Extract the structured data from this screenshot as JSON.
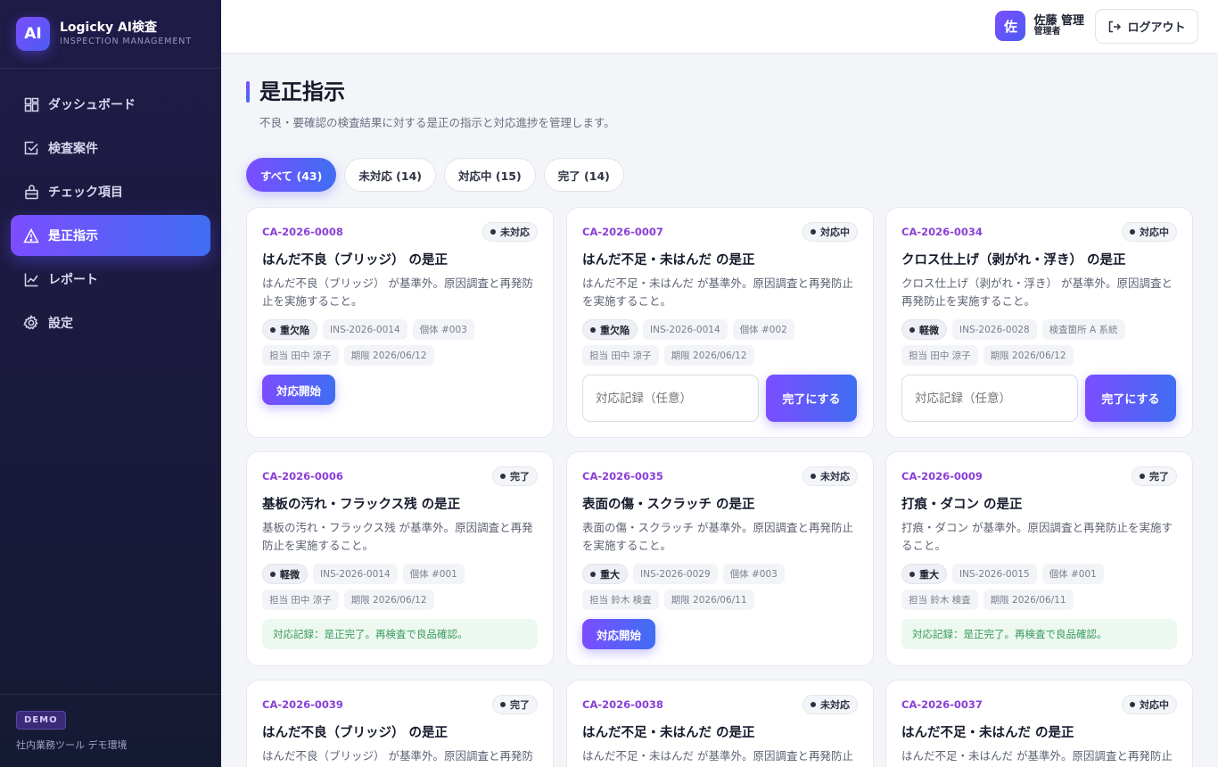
{
  "app": {
    "logo": "AI",
    "title": "Logicky AI検査",
    "subtitle": "INSPECTION MANAGEMENT"
  },
  "sidebar": {
    "items": [
      {
        "label": "ダッシュボード",
        "icon": "dashboard-icon"
      },
      {
        "label": "検査案件",
        "icon": "checkbox-icon"
      },
      {
        "label": "チェック項目",
        "icon": "clipboard-icon"
      },
      {
        "label": "是正指示",
        "icon": "warning-icon",
        "active": true
      },
      {
        "label": "レポート",
        "icon": "chart-icon"
      },
      {
        "label": "設定",
        "icon": "gear-icon"
      }
    ],
    "demo_badge": "DEMO",
    "demo_text": "社内業務ツール デモ環境"
  },
  "header": {
    "avatar": "佐",
    "user_name": "佐藤 管理",
    "user_role": "管理者",
    "logout_label": "ログアウト"
  },
  "page": {
    "title": "是正指示",
    "description": "不良・要確認の検査結果に対する是正の指示と対応進捗を管理します。"
  },
  "tabs": [
    {
      "label": "すべて (43)",
      "active": true
    },
    {
      "label": "未対応 (14)"
    },
    {
      "label": "対応中 (15)"
    },
    {
      "label": "完了 (14)"
    }
  ],
  "labels": {
    "start_button": "対応開始",
    "record_placeholder": "対応記録（任意）",
    "complete_button": "完了にする"
  },
  "cards": [
    {
      "id": "CA-2026-0008",
      "status": "未対応",
      "title": "はんだ不良（ブリッジ） の是正",
      "desc": "はんだ不良（ブリッジ） が基準外。原因調査と再発防止を実施すること。",
      "severity": "重欠陥",
      "inspection": "INS-2026-0014",
      "target": "個体 #003",
      "assignee": "担当 田中 涼子",
      "due": "期限 2026/06/12"
    },
    {
      "id": "CA-2026-0007",
      "status": "対応中",
      "title": "はんだ不足・未はんだ の是正",
      "desc": "はんだ不足・未はんだ が基準外。原因調査と再発防止を実施すること。",
      "severity": "重欠陥",
      "inspection": "INS-2026-0014",
      "target": "個体 #002",
      "assignee": "担当 田中 涼子",
      "due": "期限 2026/06/12"
    },
    {
      "id": "CA-2026-0034",
      "status": "対応中",
      "title": "クロス仕上げ（剥がれ・浮き） の是正",
      "desc": "クロス仕上げ（剥がれ・浮き） が基準外。原因調査と再発防止を実施すること。",
      "severity": "軽微",
      "inspection": "INS-2026-0028",
      "target": "検査箇所 A 系統",
      "assignee": "担当 田中 涼子",
      "due": "期限 2026/06/12"
    },
    {
      "id": "CA-2026-0006",
      "status": "完了",
      "title": "基板の汚れ・フラックス残 の是正",
      "desc": "基板の汚れ・フラックス残 が基準外。原因調査と再発防止を実施すること。",
      "severity": "軽微",
      "inspection": "INS-2026-0014",
      "target": "個体 #001",
      "assignee": "担当 田中 涼子",
      "due": "期限 2026/06/12",
      "note": "対応記録：是正完了。再検査で良品確認。"
    },
    {
      "id": "CA-2026-0035",
      "status": "未対応",
      "title": "表面の傷・スクラッチ の是正",
      "desc": "表面の傷・スクラッチ が基準外。原因調査と再発防止を実施すること。",
      "severity": "重大",
      "inspection": "INS-2026-0029",
      "target": "個体 #003",
      "assignee": "担当 鈴木 検査",
      "due": "期限 2026/06/11"
    },
    {
      "id": "CA-2026-0009",
      "status": "完了",
      "title": "打痕・ダコン の是正",
      "desc": "打痕・ダコン が基準外。原因調査と再発防止を実施すること。",
      "severity": "重大",
      "inspection": "INS-2026-0015",
      "target": "個体 #001",
      "assignee": "担当 鈴木 検査",
      "due": "期限 2026/06/11",
      "note": "対応記録：是正完了。再検査で良品確認。"
    },
    {
      "id": "CA-2026-0039",
      "status": "完了",
      "title": "はんだ不良（ブリッジ） の是正",
      "desc": "はんだ不良（ブリッジ） が基準外。原因調査と再発防止を実施すること。"
    },
    {
      "id": "CA-2026-0038",
      "status": "未対応",
      "title": "はんだ不足・未はんだ の是正",
      "desc": "はんだ不足・未はんだ が基準外。原因調査と再発防止を実施すること。"
    },
    {
      "id": "CA-2026-0037",
      "status": "対応中",
      "title": "はんだ不足・未はんだ の是正",
      "desc": "はんだ不足・未はんだ が基準外。原因調査と再発防止を実施すること。"
    }
  ]
}
